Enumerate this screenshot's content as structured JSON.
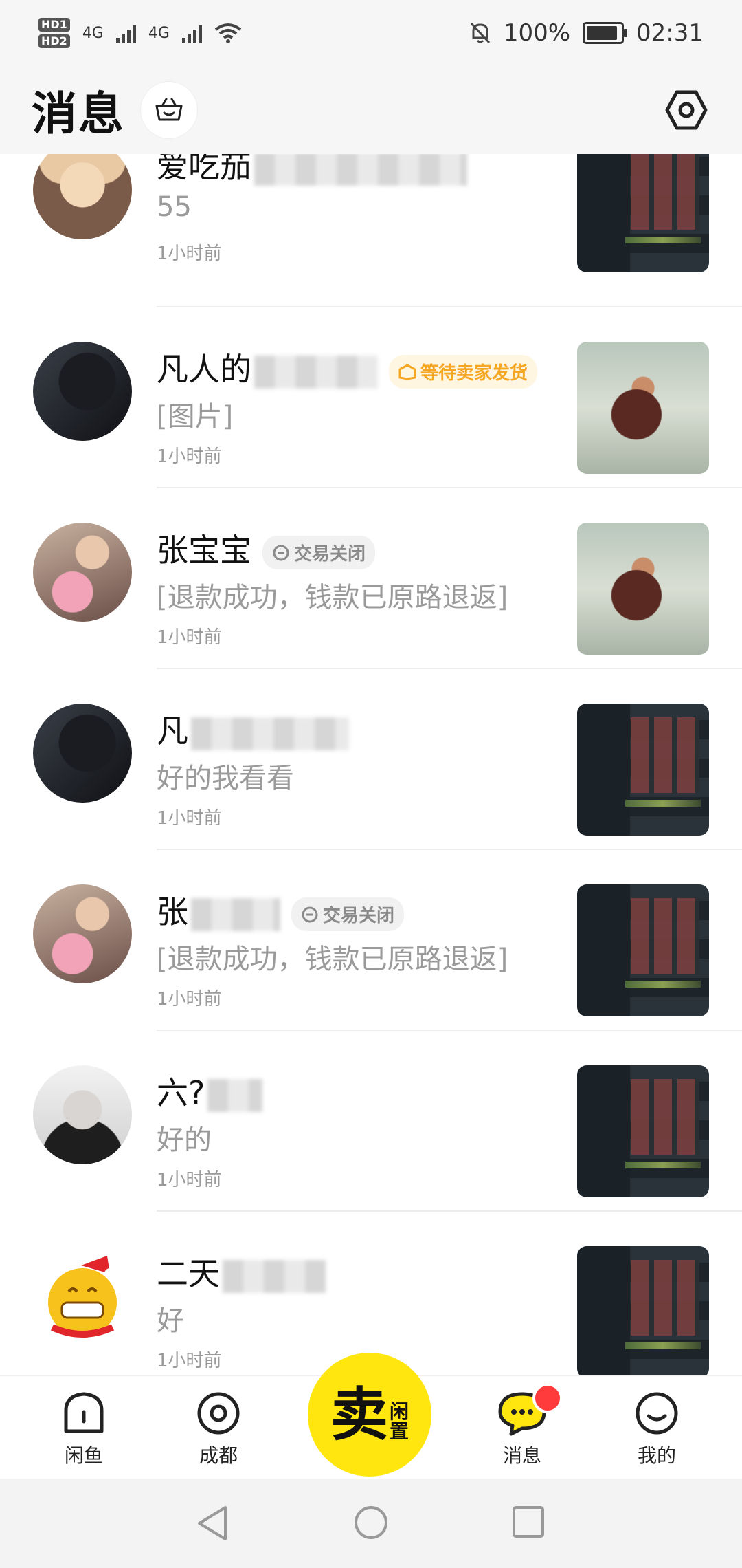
{
  "status_bar": {
    "hd1": "HD1",
    "hd2": "HD2",
    "net1": "4G",
    "net2": "4G",
    "battery": "100%",
    "time": "02:31"
  },
  "header": {
    "title": "消息"
  },
  "messages": [
    {
      "name": "爱吃茄",
      "preview": "55",
      "time": "1小时前",
      "badge": "",
      "thumb": "game-screenshot"
    },
    {
      "name": "凡人的",
      "preview": "[图片]",
      "time": "1小时前",
      "badge": "等待卖家发货",
      "badge_type": "wait",
      "thumb": "ink-painting"
    },
    {
      "name": "张宝宝",
      "preview": "[退款成功，钱款已原路退返]",
      "time": "1小时前",
      "badge": "交易关闭",
      "badge_type": "closed",
      "thumb": "ink-painting"
    },
    {
      "name": "凡",
      "preview": "好的我看看",
      "time": "1小时前",
      "badge": "",
      "thumb": "game-screenshot"
    },
    {
      "name": "张",
      "preview": "[退款成功，钱款已原路退返]",
      "time": "1小时前",
      "badge": "交易关闭",
      "badge_type": "closed",
      "thumb": "game-screenshot"
    },
    {
      "name": "六?",
      "preview": "好的",
      "time": "1小时前",
      "badge": "",
      "thumb": "game-screenshot"
    },
    {
      "name": "二天",
      "preview": "好",
      "time": "1小时前",
      "badge": "",
      "thumb": "game-screenshot"
    }
  ],
  "bottom_nav": {
    "home": "闲鱼",
    "city": "成都",
    "sell_main": "卖",
    "sell_sub1": "闲",
    "sell_sub2": "置",
    "messages": "消息",
    "mine": "我的"
  },
  "colors": {
    "accent": "#ffe60f",
    "badge_wait": "#f5a623",
    "notify": "#ff3b3b"
  }
}
